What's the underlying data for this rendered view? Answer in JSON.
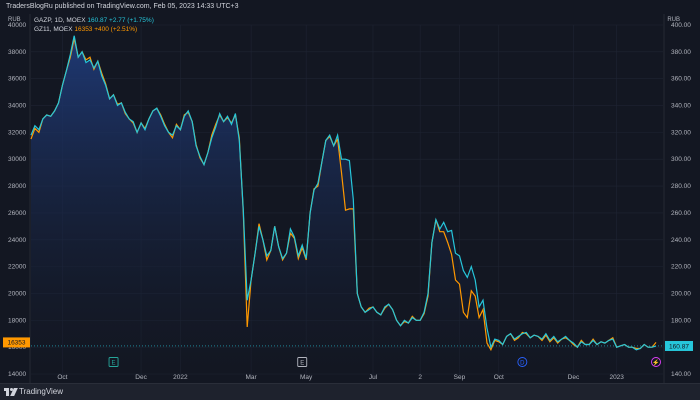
{
  "header": {
    "published_by": "TradersBlogRu published on TradingView.com, Feb 05, 2023 14:33 UTC+3",
    "left_axis_unit": "RUB",
    "right_axis_unit": "RUB"
  },
  "legend": [
    {
      "symbol": "GAZP, 1D, MOEX",
      "value_text": "160.87  +2.77 (+1.75%)",
      "color": "#26c6da"
    },
    {
      "symbol": "GZ11, MOEX",
      "value_text": "16353  +400 (+2.51%)",
      "color": "#ff9800"
    }
  ],
  "price_tags": {
    "left": "16353",
    "right": "160.87"
  },
  "event_markers": [
    {
      "letter": "E",
      "color": "#26a69a",
      "x_index": 21
    },
    {
      "letter": "E",
      "color": "#b2b5be",
      "x_index": 69
    },
    {
      "letter": "D",
      "color": "#2962ff",
      "x_index": 125
    },
    {
      "letter": "⚡",
      "color": "#e040fb",
      "x_index": 159
    }
  ],
  "footer": {
    "brand": "TradingView"
  },
  "colors": {
    "background": "#131722",
    "gazp_line": "#26c6da",
    "gz11_line": "#ff9800",
    "area_top": "#1f3b7a",
    "grid": "#1f2433"
  },
  "chart_data": {
    "type": "line",
    "x_tick_labels": [
      "Oct",
      "Dec",
      "2022",
      "Mar",
      "May",
      "Jul",
      "2",
      "Sep",
      "Oct",
      "Dec",
      "2023"
    ],
    "x_tick_index": [
      8,
      28,
      38,
      56,
      70,
      87,
      99,
      109,
      119,
      138,
      149
    ],
    "left_axis": {
      "min": 14000,
      "max": 40000,
      "ticks": [
        14000,
        16000,
        18000,
        20000,
        22000,
        24000,
        26000,
        28000,
        30000,
        32000,
        34000,
        36000,
        38000,
        40000
      ]
    },
    "right_axis": {
      "min": 140,
      "max": 400,
      "ticks": [
        "140.00",
        "160.00",
        "180.00",
        "200.00",
        "220.00",
        "240.00",
        "260.00",
        "280.00",
        "300.00",
        "320.00",
        "340.00",
        "360.00",
        "380.00",
        "400.00"
      ]
    },
    "series": [
      {
        "name": "GAZP, 1D, MOEX",
        "axis": "right",
        "values": [
          318,
          325,
          322,
          330,
          333,
          332,
          336,
          342,
          355,
          366,
          378,
          392,
          376,
          380,
          372,
          374,
          368,
          373,
          362,
          355,
          345,
          348,
          340,
          342,
          335,
          330,
          328,
          320,
          327,
          322,
          330,
          336,
          338,
          332,
          325,
          320,
          318,
          325,
          322,
          332,
          336,
          328,
          310,
          302,
          296,
          305,
          316,
          324,
          334,
          328,
          332,
          326,
          334,
          314,
          262,
          195,
          210,
          230,
          250,
          240,
          228,
          232,
          250,
          235,
          226,
          230,
          248,
          242,
          228,
          236,
          226,
          260,
          277,
          282,
          298,
          314,
          318,
          310,
          318,
          300,
          300,
          299,
          270,
          200,
          190,
          186,
          188,
          190,
          186,
          184,
          190,
          192,
          188,
          180,
          176,
          180,
          178,
          182,
          180,
          180,
          186,
          200,
          238,
          255,
          248,
          253,
          246,
          247,
          230,
          228,
          217,
          212,
          220,
          210,
          190,
          195,
          174,
          160,
          166,
          165,
          162,
          168,
          170,
          166,
          168,
          170,
          171,
          167,
          169,
          168,
          166,
          170,
          165,
          168,
          164,
          166,
          168,
          165,
          163,
          160,
          164,
          162,
          162,
          165,
          162,
          164,
          163,
          165,
          166,
          160,
          161,
          162,
          160,
          160,
          158,
          159,
          162,
          160,
          160,
          160.87
        ]
      },
      {
        "name": "GZ11, MOEX",
        "axis": "left",
        "values": [
          31500,
          32300,
          32000,
          33000,
          33300,
          33200,
          33600,
          34200,
          35500,
          36600,
          37600,
          39000,
          37600,
          38000,
          37400,
          37600,
          36700,
          37300,
          36400,
          35600,
          34500,
          34800,
          34100,
          34200,
          33400,
          33000,
          32700,
          32000,
          32700,
          32300,
          33000,
          33600,
          33800,
          33300,
          32600,
          32000,
          31600,
          32600,
          32200,
          33300,
          33500,
          32800,
          31100,
          30100,
          29600,
          30500,
          31800,
          32600,
          33300,
          32800,
          33100,
          32700,
          33300,
          31600,
          26000,
          17500,
          21000,
          23000,
          25200,
          24000,
          22500,
          23200,
          25000,
          23500,
          22500,
          23000,
          24500,
          24100,
          22600,
          23400,
          22500,
          26000,
          27800,
          28000,
          29800,
          31400,
          31700,
          31000,
          31500,
          29000,
          26200,
          26300,
          26300,
          20000,
          19000,
          18600,
          18900,
          19000,
          18600,
          18400,
          18900,
          19200,
          18800,
          18000,
          17600,
          17900,
          17800,
          18300,
          18000,
          18000,
          18500,
          19800,
          23800,
          25500,
          24600,
          24600,
          23800,
          22900,
          21000,
          20700,
          18600,
          18200,
          20200,
          19800,
          18200,
          18800,
          16300,
          15800,
          16500,
          16400,
          16200,
          16800,
          17000,
          16500,
          16700,
          17100,
          17000,
          16700,
          16900,
          16800,
          16500,
          16900,
          16400,
          16700,
          16300,
          16600,
          16700,
          16500,
          16200,
          16000,
          16500,
          16200,
          16200,
          16600,
          16200,
          16400,
          16300,
          16500,
          16700,
          16000,
          16100,
          16200,
          16000,
          16000,
          15900,
          15900,
          16200,
          16000,
          16000,
          16353
        ]
      }
    ]
  }
}
